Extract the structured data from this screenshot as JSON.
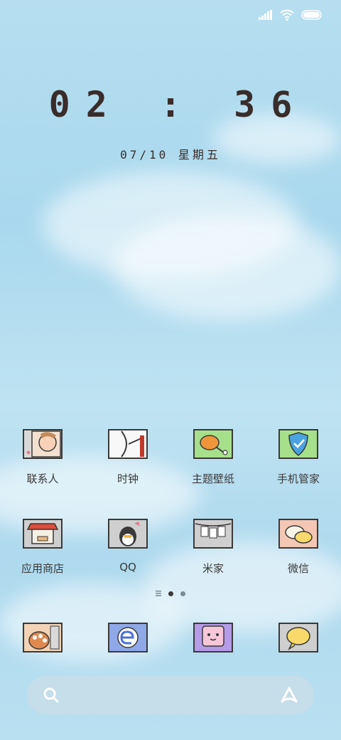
{
  "status_bar": {
    "signal": "signal-icon",
    "wifi": "wifi-icon",
    "battery": "battery-icon"
  },
  "clock": {
    "time": "02 : 36",
    "date": "07/10 星期五"
  },
  "apps_row1": [
    {
      "label": "联系人",
      "icon": "contacts-icon"
    },
    {
      "label": "时钟",
      "icon": "clock-icon"
    },
    {
      "label": "主题壁纸",
      "icon": "theme-icon"
    },
    {
      "label": "手机管家",
      "icon": "security-icon"
    }
  ],
  "apps_row2": [
    {
      "label": "应用商店",
      "icon": "app-store-icon"
    },
    {
      "label": "QQ",
      "icon": "qq-icon"
    },
    {
      "label": "米家",
      "icon": "mijia-icon"
    },
    {
      "label": "微信",
      "icon": "wechat-icon"
    }
  ],
  "dock": [
    {
      "icon": "phone-icon"
    },
    {
      "icon": "browser-icon"
    },
    {
      "icon": "messages-icon"
    },
    {
      "icon": "love-chat-icon"
    }
  ],
  "page_indicator": {
    "pages": 2,
    "current": 1
  },
  "search_bar": {
    "search_icon": "search-icon",
    "assistant_icon": "assistant-icon"
  }
}
